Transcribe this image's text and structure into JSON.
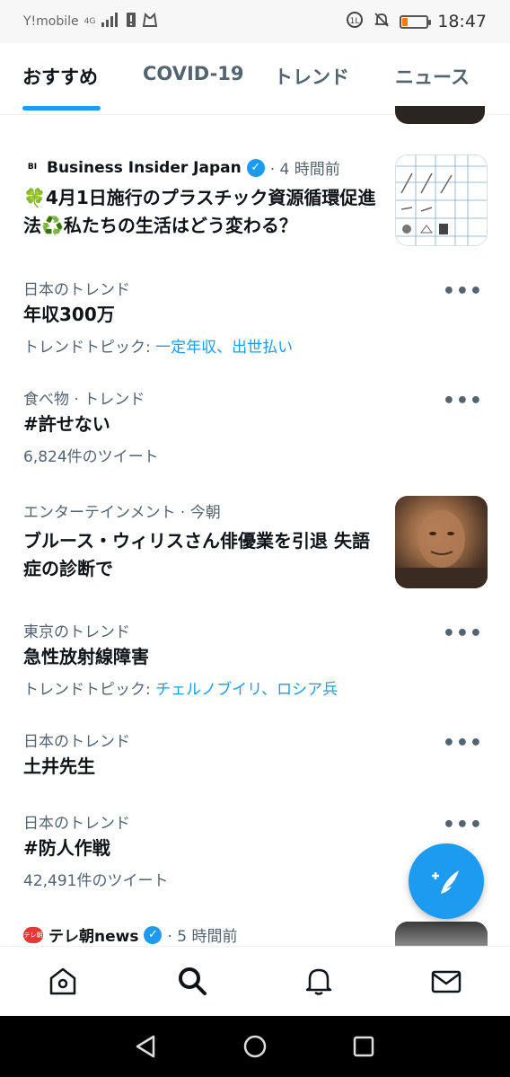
{
  "status_bar": {
    "carrier": "Y!mobile",
    "network": "4G",
    "time": "18:47",
    "battery_color": "#f57c00"
  },
  "tabs": [
    {
      "label": "おすすめ",
      "active": true
    },
    {
      "label": "COVID-19",
      "active": false
    },
    {
      "label": "トレンド",
      "active": false
    },
    {
      "label": "ニュース",
      "active": false
    }
  ],
  "feed": {
    "news1": {
      "source": "Business Insider Japan",
      "time": "· 4 時間前",
      "logo": "BI",
      "title": "🍀4月1日施行のプラスチック資源循環促進法♻️私たちの生活はどう変わる？"
    },
    "trend1": {
      "category": "日本のトレンド",
      "title": "年収300万",
      "sub_prefix": "トレンドトピック: ",
      "sub_links": "一定年収、出世払い"
    },
    "trend2": {
      "category": "食べ物 · トレンド",
      "title": "#許せない",
      "sub": "6,824件のツイート"
    },
    "news2": {
      "category": "エンターテインメント · 今朝",
      "title": "ブルース・ウィリスさん俳優業を引退 失語症の診断で"
    },
    "trend3": {
      "category": "東京のトレンド",
      "title": "急性放射線障害",
      "sub_prefix": "トレンドトピック: ",
      "sub_links": "チェルノブイリ、ロシア兵"
    },
    "trend4": {
      "category": "日本のトレンド",
      "title": "土井先生"
    },
    "trend5": {
      "category": "日本のトレンド",
      "title": "#防人作戦",
      "sub": "42,491件のツイート"
    },
    "news3": {
      "source": "テレ朝news",
      "time": "· 5 時間前",
      "logo": "テレ朝"
    }
  },
  "more_label": "•••",
  "accent_color": "#1d9bf0"
}
